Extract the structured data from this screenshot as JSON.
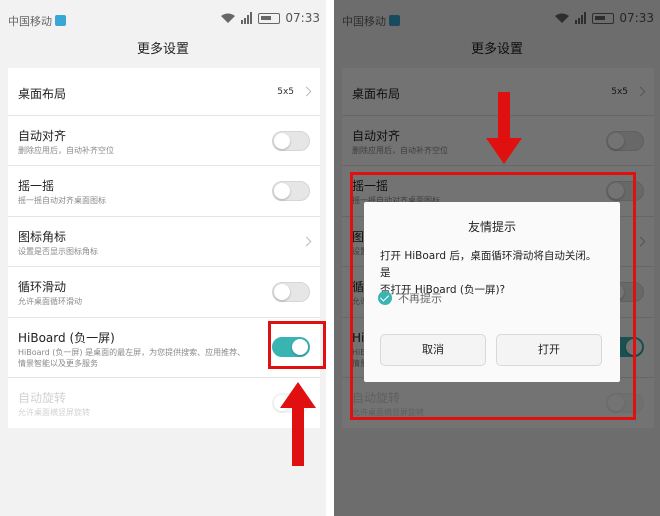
{
  "status": {
    "carrier": "中国移动",
    "time": "07:33"
  },
  "header": {
    "title": "更多设置"
  },
  "settings": [
    {
      "title": "桌面布局",
      "value": "5x5"
    },
    {
      "title": "自动对齐",
      "subtitle": "删除应用后，自动补齐空位",
      "enabled": false
    },
    {
      "title": "摇一摇",
      "subtitle": "摇一摇自动对齐桌面图标",
      "enabled": false
    },
    {
      "title": "图标角标",
      "subtitle": "设置是否显示图标角标"
    },
    {
      "title": "循环滑动",
      "subtitle": "允许桌面循环滑动",
      "enabled": false
    },
    {
      "title": "HiBoard (负一屏)",
      "subtitle_line1": "HiBoard (负一屏) 是桌面的最左屏，为您提供搜索、应用推荐、",
      "subtitle_line2": "情景智能以及更多服务",
      "enabled": true
    },
    {
      "title": "自动旋转",
      "subtitle": "允许桌面横竖屏旋转",
      "enabled": false
    }
  ],
  "dialog": {
    "title": "友情提示",
    "message_line1": "打开 HiBoard 后，桌面循环滑动将自动关闭。是",
    "message_line2": "否打开 HiBoard (负一屏)?",
    "checkbox_label": "不再提示",
    "checkbox_checked": true,
    "cancel_label": "取消",
    "confirm_label": "打开"
  },
  "colors": {
    "accent": "#3ab4b2",
    "highlight": "#e01010"
  }
}
